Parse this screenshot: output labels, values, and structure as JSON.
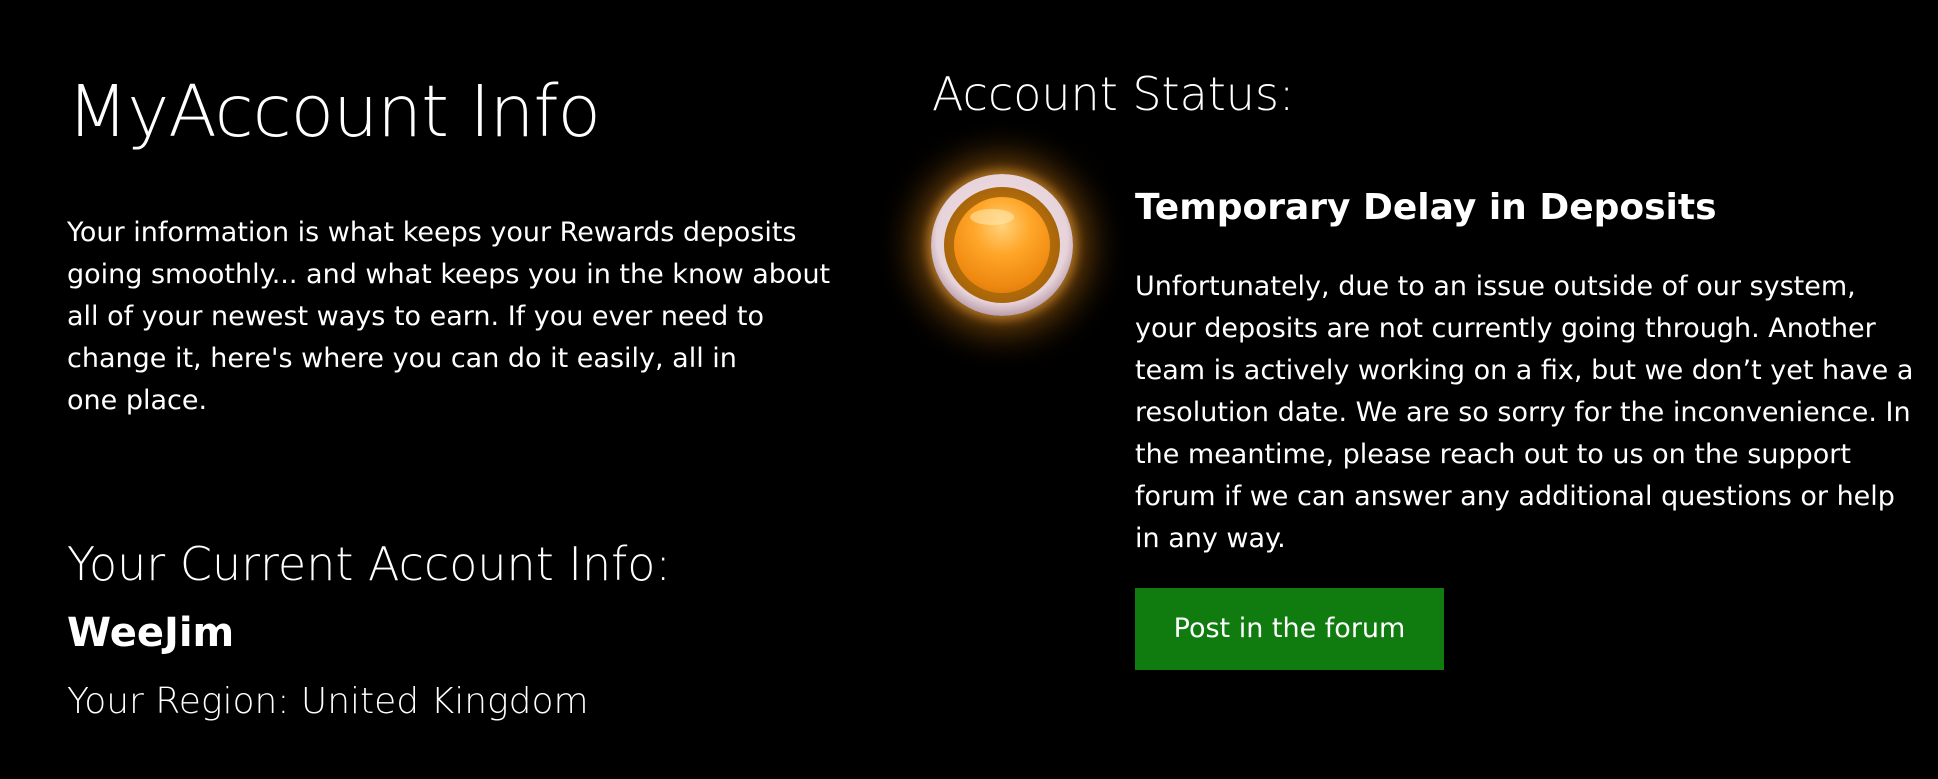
{
  "account": {
    "title": "MyAccount Info",
    "intro_lines": [
      "Your information is what keeps your Rewards deposits",
      "going smoothly... and what keeps you in the know about",
      "all of your newest ways to earn. If you ever need to",
      "change it, here's where you can do it easily, all in",
      "one place."
    ],
    "current_info_title": "Your Current Account Info:",
    "username": "WeeJim",
    "region": "Your Region: United Kingdom"
  },
  "status": {
    "title": "Account Status:",
    "indicator_icon": "orange-status-light-icon",
    "indicator_color": "#f7941d",
    "heading": "Temporary Delay in Deposits",
    "body_lines": [
      "Unfortunately, due to an issue outside of our system,",
      "your deposits are not currently going through. Another",
      "team is actively working on a fix, but we don’t yet have a",
      "resolution date. We are so sorry for the inconvenience. In",
      "the meantime, please reach out to us on the support",
      "forum if we can answer any additional questions or help",
      "in any way."
    ],
    "button_label": "Post in the forum",
    "button_color": "#107c10"
  }
}
